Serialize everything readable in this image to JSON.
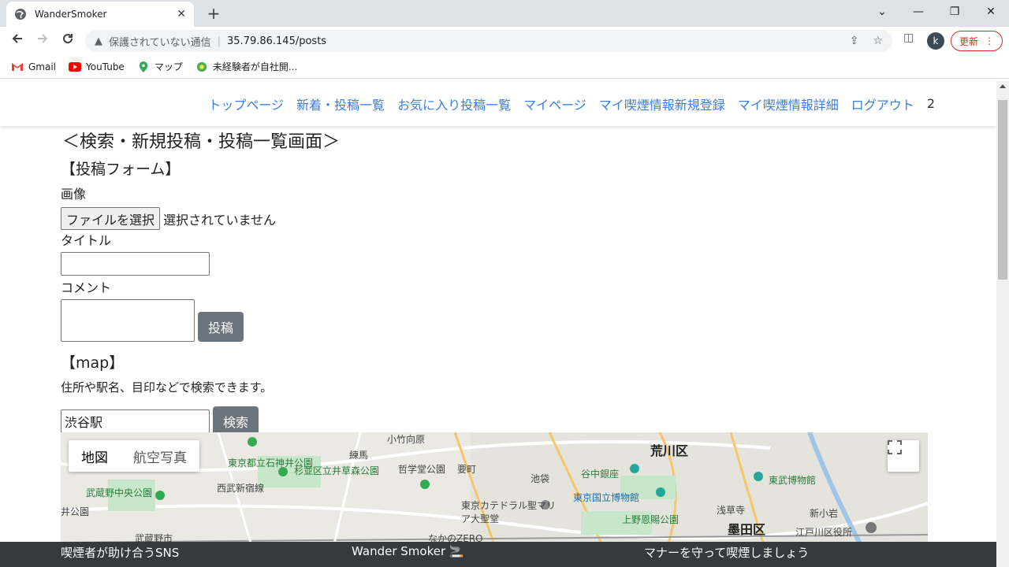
{
  "browser": {
    "tab_title": "WanderSmoker",
    "new_tab": "+",
    "min": "—",
    "restore": "❐",
    "close": "✕",
    "tab_list": "⌄"
  },
  "toolbar": {
    "not_secure": "保護されていない通信",
    "url": "35.79.86.145/posts",
    "avatar_letter": "k",
    "update_label": "更新"
  },
  "bookmarks": [
    {
      "label": "Gmail"
    },
    {
      "label": "YouTube"
    },
    {
      "label": "マップ"
    },
    {
      "label": "未経験者が自社開..."
    }
  ],
  "nav": {
    "items": [
      "トップページ",
      "新着・投稿一覧",
      "お気に入り投稿一覧",
      "マイページ",
      "マイ喫煙情報新規登録",
      "マイ喫煙情報詳細",
      "ログアウト"
    ],
    "count": "2"
  },
  "main": {
    "heading": "＜検索・新規投稿・投稿一覧画面＞",
    "form_title": "【投稿フォーム】",
    "image_label": "画像",
    "file_button": "ファイルを選択",
    "file_state": "選択されていません",
    "title_label": "タイトル",
    "title_value": "",
    "comment_label": "コメント",
    "post_button": "投稿",
    "map_title": "【map】",
    "map_desc": "住所や駅名、目印などで検索できます。",
    "search_value": "渋谷駅",
    "search_button": "検索"
  },
  "map": {
    "type_map": "地図",
    "type_satellite": "航空写真",
    "labels": [
      "小竹向原",
      "荒川区",
      "東京都立石神井公園",
      "杉並区立井草森公園",
      "練馬",
      "哲学堂公園",
      "要町",
      "池袋",
      "谷中銀座",
      "東武博物館",
      "武蔵野中央公園",
      "西武新宿線",
      "東京国立博物館",
      "浅草寺",
      "新小岩",
      "井公園",
      "東京カテドラル聖マリア大聖堂",
      "上野恩賜公園",
      "墨田区",
      "江戸川区役所",
      "武蔵野市",
      "なかのZERO"
    ]
  },
  "footer": {
    "left": "喫煙者が助け合うSNS",
    "center": "Wander Smoker 🚬",
    "right": "マナーを守って喫煙しましょう"
  }
}
